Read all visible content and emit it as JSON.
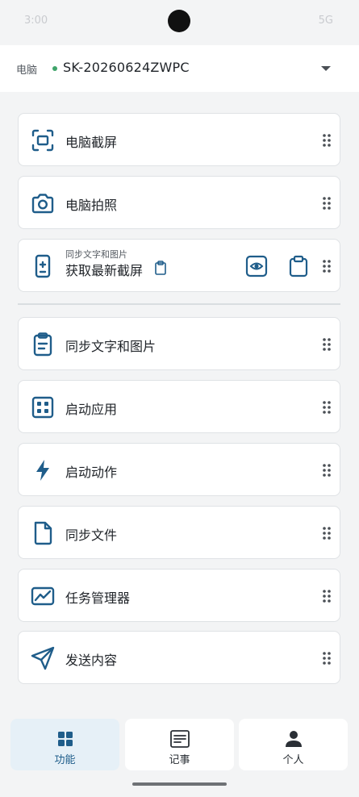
{
  "status_bar": {
    "time": "3:00",
    "right": "5G"
  },
  "device": {
    "label": "电脑",
    "name": "SK-20260624ZWPC"
  },
  "cards": [
    {
      "label": "电脑截屏",
      "icon": "screenshot-frame-icon"
    },
    {
      "label": "电脑拍照",
      "icon": "camera-icon"
    },
    {
      "sublabel": "同步文字和图片",
      "label": "获取最新截屏",
      "icon": "phone-screenshot-icon"
    },
    {
      "label": "同步文字和图片",
      "icon": "clipboard-icon"
    },
    {
      "label": "启动应用",
      "icon": "apps-grid-icon"
    },
    {
      "label": "启动动作",
      "icon": "lightning-icon"
    },
    {
      "label": "同步文件",
      "icon": "file-icon"
    },
    {
      "label": "任务管理器",
      "icon": "chart-line-icon"
    },
    {
      "label": "发送内容",
      "icon": "send-icon"
    }
  ],
  "bottom_nav": [
    {
      "label": "功能",
      "icon": "apps-grid-icon",
      "active": true
    },
    {
      "label": "记事",
      "icon": "notes-icon",
      "active": false
    },
    {
      "label": "个人",
      "icon": "person-icon",
      "active": false
    }
  ],
  "colors": {
    "accent": "#1f5d8a",
    "background": "#f3f4f5",
    "card": "#ffffff",
    "status_dot": "#3fa46a"
  }
}
